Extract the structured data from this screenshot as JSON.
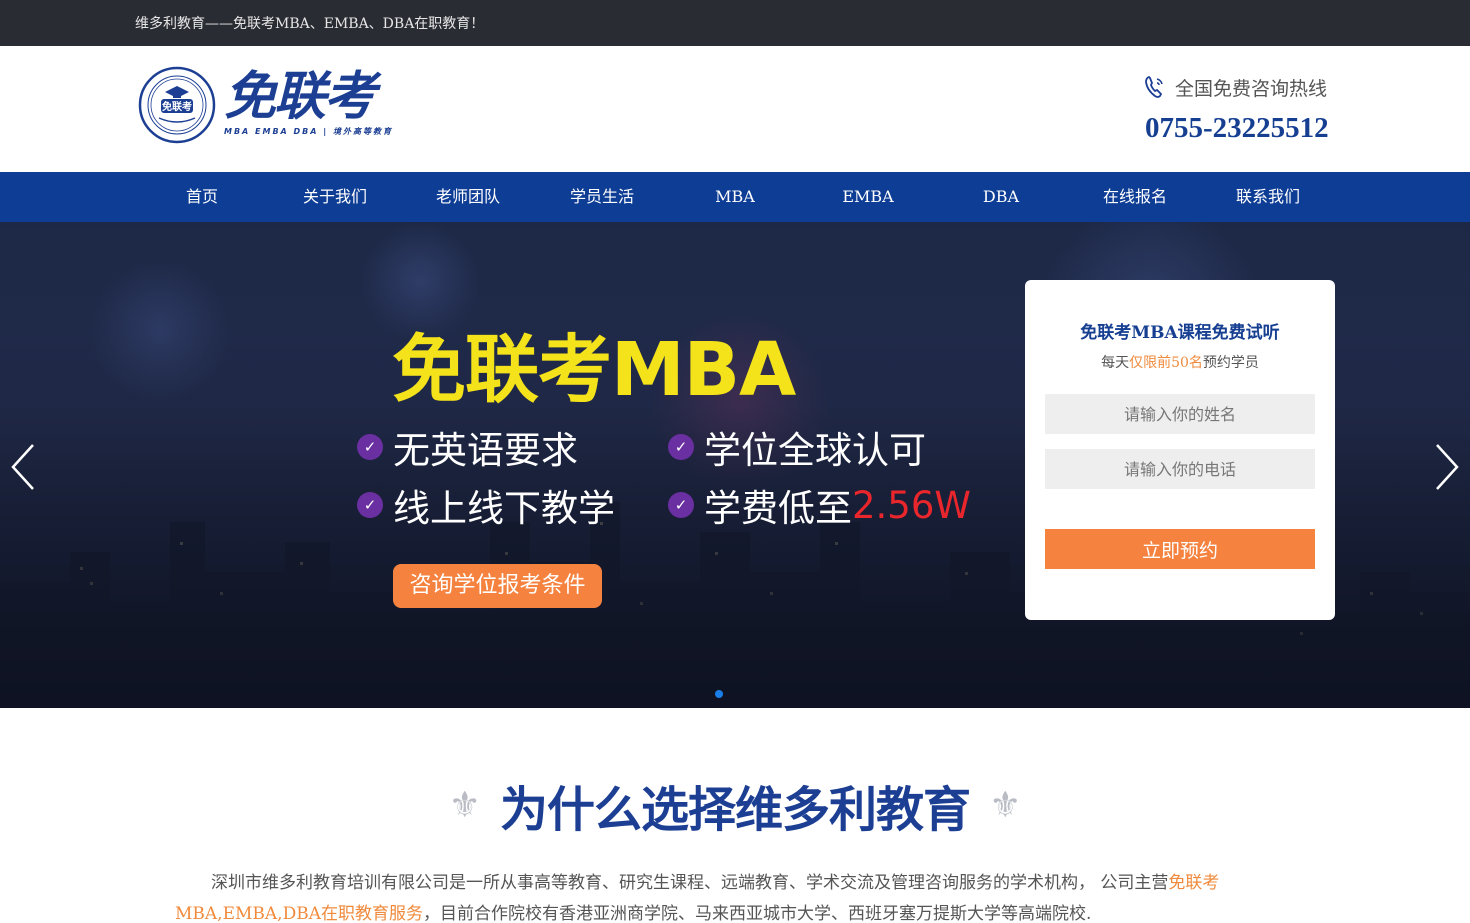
{
  "topbar": {
    "text": "维多利教育——免联考MBA、EMBA、DBA在职教育！"
  },
  "header": {
    "logo_name": "免联考",
    "logo_sub": "MBA EMBA DBA | 境外高等教育",
    "seal_text": "免联考",
    "phone_label": "全国免费咨询热线",
    "phone_number": "0755-23225512"
  },
  "nav": {
    "items": [
      {
        "label": "首页"
      },
      {
        "label": "关于我们"
      },
      {
        "label": "老师团队"
      },
      {
        "label": "学员生活"
      },
      {
        "label": "MBA"
      },
      {
        "label": "EMBA"
      },
      {
        "label": "DBA"
      },
      {
        "label": "在线报名"
      },
      {
        "label": "联系我们"
      }
    ]
  },
  "banner": {
    "title": "免联考MBA",
    "features": [
      {
        "text": "无英语要求"
      },
      {
        "text": "学位全球认可"
      },
      {
        "text": "线上线下教学"
      },
      {
        "text": "学费低至",
        "highlight": "2.56W"
      }
    ],
    "consult_button": "咨询学位报考条件",
    "check_icon": "✓",
    "colors": {
      "title": "#f4e21b",
      "highlight": "#e8262b",
      "button": "#f5823e",
      "check": "#6a2fa0"
    }
  },
  "form": {
    "title": "免联考MBA课程免费试听",
    "sub_prefix": "每天",
    "sub_highlight": "仅限前50名",
    "sub_suffix": "预约学员",
    "name_placeholder": "请输入你的姓名",
    "phone_placeholder": "请输入你的电话",
    "submit_label": "立即预约"
  },
  "section": {
    "title": "为什么选择维多利教育",
    "ornament": "⚜",
    "intro_prefix": "深圳市维多利教育培训有限公司是一所从事高等教育、研究生课程、远端教育、学术交流及管理咨询服务的学术机构， 公司主营",
    "intro_highlight": "免联考MBA,EMBA,DBA在职教育服务",
    "intro_suffix": "，目前合作院校有香港亚洲商学院、马来西亚城市大学、西班牙塞万提斯大学等高端院校."
  },
  "colors": {
    "nav_bg": "#0e3d95",
    "brand_blue": "#1c3f94",
    "accent_orange": "#f5823e",
    "topbar_bg": "#2a2c33"
  }
}
